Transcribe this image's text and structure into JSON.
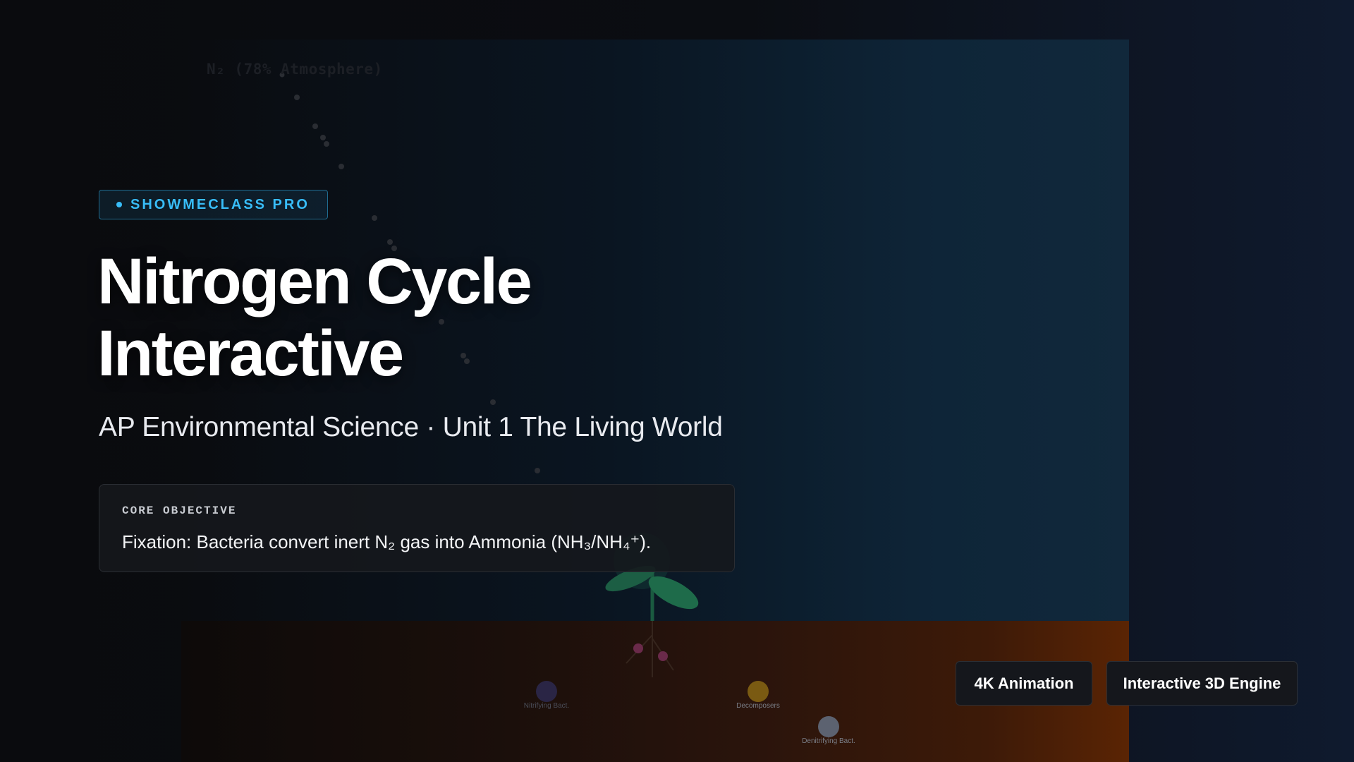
{
  "scene": {
    "atmosphere_label": "N₂ (78% Atmosphere)",
    "organisms": [
      {
        "name": "nitrifying",
        "label": "Nitrifying Bact.",
        "color": "#2a2545"
      },
      {
        "name": "decomposers",
        "label": "Decomposers",
        "color": "#7a5a12"
      },
      {
        "name": "denitrifying",
        "label": "Denitrifying Bact.",
        "color": "#5c6270"
      }
    ],
    "colors": {
      "soil": "#5a2404",
      "sky": "#11283b",
      "plant": "#1e6b4a"
    }
  },
  "badge": {
    "label": "SHOWMECLASS PRO",
    "color": "#38bdf8"
  },
  "title": {
    "line1": "Nitrogen Cycle",
    "line2": "Interactive"
  },
  "subtitle": "AP Environmental Science · Unit 1 The Living World",
  "objective": {
    "label": "CORE OBJECTIVE",
    "text": "Fixation: Bacteria convert inert N₂ gas into Ammonia (NH₃/NH₄⁺)."
  },
  "chips": [
    "4K Animation",
    "Interactive 3D Engine"
  ]
}
